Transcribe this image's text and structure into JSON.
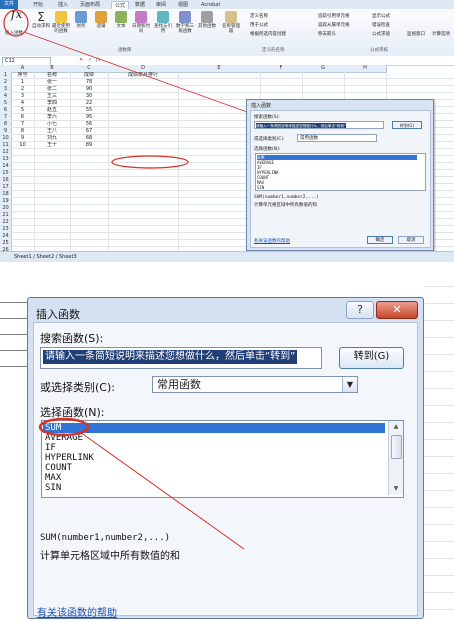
{
  "excel": {
    "tabs": [
      {
        "label": "文件"
      },
      {
        "label": "开始"
      },
      {
        "label": "插入"
      },
      {
        "label": "页面布局"
      },
      {
        "label": "公式"
      },
      {
        "label": "数据"
      },
      {
        "label": "审阅"
      },
      {
        "label": "视图"
      },
      {
        "label": "Acrobat"
      }
    ],
    "ribbon": {
      "insert_function": "插入函数",
      "buttons": [
        {
          "label": "自动求和"
        },
        {
          "label": "最近使用的函数"
        },
        {
          "label": "财务"
        },
        {
          "label": "逻辑"
        },
        {
          "label": "文本"
        },
        {
          "label": "日期和时间"
        },
        {
          "label": "查找与引用"
        },
        {
          "label": "数学和三角函数"
        },
        {
          "label": "其他函数"
        },
        {
          "label": "名称管理器"
        }
      ],
      "name_group": [
        "定义名称",
        "用于公式",
        "根据所选内容创建"
      ],
      "audit_group": [
        "追踪引用单元格",
        "追踪从属单元格",
        "移去箭头",
        "显示公式",
        "错误检查",
        "公式求值",
        "监视窗口",
        "计算选项"
      ],
      "groups": [
        "函数库",
        "定义的名称",
        "公式审核"
      ]
    },
    "name_box": "C12",
    "formula_symbols": {
      "cancel": "✕",
      "enter": "✓",
      "fx": "fx"
    },
    "columns": [
      "A",
      "B",
      "C",
      "D",
      "E",
      "F",
      "G",
      "H"
    ],
    "header_row": {
      "a": "序号",
      "b": "名称",
      "c": "成绩",
      "d": "成绩单月排行"
    },
    "rows": [
      {
        "n": "1",
        "name": "张一",
        "score": "78"
      },
      {
        "n": "2",
        "name": "张二",
        "score": "90"
      },
      {
        "n": "3",
        "name": "王三",
        "score": "30"
      },
      {
        "n": "4",
        "name": "李四",
        "score": "22"
      },
      {
        "n": "5",
        "name": "赵五",
        "score": "55"
      },
      {
        "n": "6",
        "name": "李六",
        "score": "95"
      },
      {
        "n": "7",
        "name": "小七",
        "score": "56"
      },
      {
        "n": "8",
        "name": "王八",
        "score": "67"
      },
      {
        "n": "9",
        "name": "刘九",
        "score": "68"
      },
      {
        "n": "10",
        "name": "王十",
        "score": "89"
      }
    ],
    "row_numbers": [
      "1",
      "2",
      "3",
      "4",
      "5",
      "6",
      "7",
      "8",
      "9",
      "10",
      "11",
      "12",
      "13",
      "14",
      "15",
      "16",
      "17",
      "18",
      "19",
      "20",
      "21",
      "22",
      "23",
      "24",
      "25",
      "26"
    ],
    "sheet_tabs": "Sheet1 / Sheet2 / Sheet3",
    "small_dialog": {
      "title": "插入函数",
      "search_label": "搜索函数(S):",
      "search_value": "请输入一条简短说明来描述您想做什么，然后单击“转到”",
      "go_button": "转到(G)",
      "category_label": "或选择类别(C):",
      "category_value": "常用函数",
      "list_label": "选择函数(N):",
      "functions": [
        "SUM",
        "AVERAGE",
        "IF",
        "HYPERLINK",
        "COUNT",
        "MAX",
        "SIN"
      ],
      "signature": "SUM(number1,number2,...)",
      "description": "计算单元格区域中所有数值的和",
      "help_link": "有关该函数的帮助",
      "ok_button": "确定",
      "cancel_button": "取消"
    }
  },
  "dialog": {
    "title": "插入函数",
    "help_button": "?",
    "close_button": "✕",
    "search_label": "搜索函数(S):",
    "search_value": "请输入一条简短说明来描述您想做什么，然后单击“转到”",
    "go_button": "转到(G)",
    "category_label": "或选择类别(C):",
    "category_value": "常用函数",
    "list_label": "选择函数(N):",
    "functions": [
      "SUM",
      "AVERAGE",
      "IF",
      "HYPERLINK",
      "COUNT",
      "MAX",
      "SIN"
    ],
    "signature": "SUM(number1,number2,...)",
    "description": "计算单元格区域中所有数值的和",
    "help_link": "有关该函数的帮助"
  },
  "colors": {
    "highlight": "#3274d5",
    "annotation": "#d9302a",
    "link": "#1a4fb0"
  }
}
